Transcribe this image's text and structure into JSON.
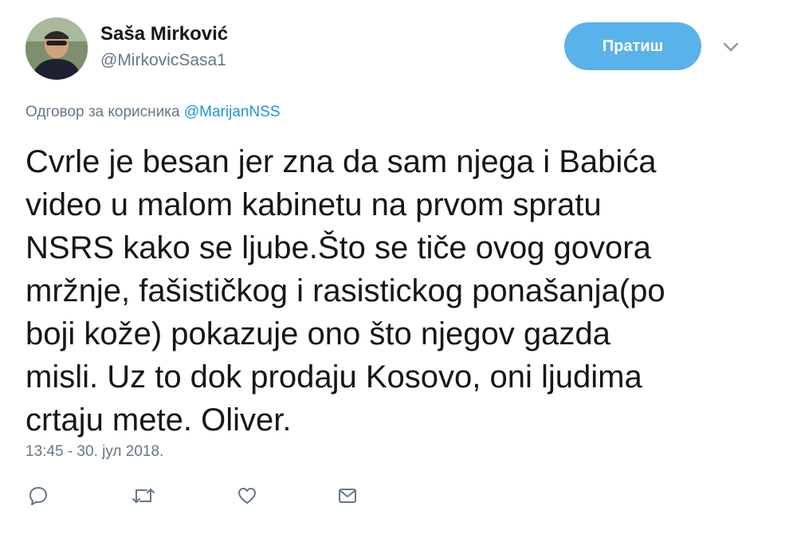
{
  "author": {
    "display_name": "Saša Mirković",
    "handle": "@MirkovicSasa1",
    "avatar_icon": "profile-photo"
  },
  "header": {
    "follow_label": "Пратиш",
    "follow_color": "#5ab2ea",
    "menu_icon": "chevron-down-icon"
  },
  "reply": {
    "prefix": "Одговор за корисника",
    "mention": "@MarijanNSS",
    "mention_color": "#1b95e0"
  },
  "tweet": {
    "lines": [
      "Cvrle je besan jer zna da sam njega i Babića",
      "video u malom kabinetu na prvom spratu",
      "NSRS kako se ljube.Što se tiče ovog govora",
      "mržnje, fašističkog i rasistickog ponašanja(po",
      "boji kože) pokazuje ono što njegov gazda",
      "misli. Uz to dok prodaju Kosovo, oni ljudima",
      "crtaju mete. Oliver."
    ],
    "timestamp": "13:45 - 30. јул 2018."
  },
  "actions": [
    {
      "name": "reply",
      "icon": "speech-bubble-icon"
    },
    {
      "name": "retweet",
      "icon": "retweet-icon"
    },
    {
      "name": "like",
      "icon": "heart-icon"
    },
    {
      "name": "direct-message",
      "icon": "envelope-icon"
    }
  ]
}
